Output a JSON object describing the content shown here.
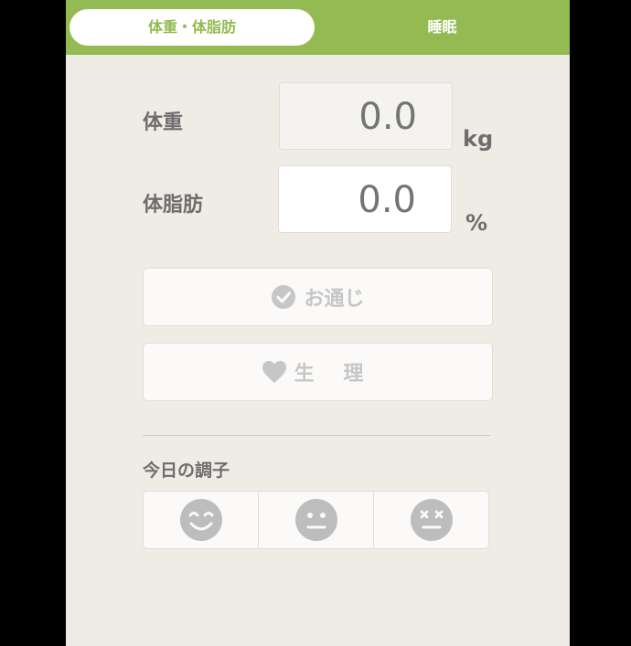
{
  "tabs": {
    "body_fat_label": "体重・体脂肪",
    "sleep_label": "睡眠"
  },
  "weight": {
    "label": "体重",
    "value": "0.0",
    "unit": "kg"
  },
  "body_fat": {
    "label": "体脂肪",
    "value": "0.0",
    "unit": "%"
  },
  "bowel_button": {
    "label": "お通じ",
    "icon": "check-circle-icon"
  },
  "period_button": {
    "label": "生 理",
    "icon": "heart-icon"
  },
  "condition": {
    "label": "今日の調子",
    "options": [
      {
        "icon": "smile-face-icon"
      },
      {
        "icon": "neutral-face-icon"
      },
      {
        "icon": "dizzy-face-icon"
      }
    ]
  },
  "colors": {
    "accent": "#93bb51",
    "background": "#efebe5",
    "text": "#6e6e6e",
    "disabled": "#c6c6c6"
  }
}
